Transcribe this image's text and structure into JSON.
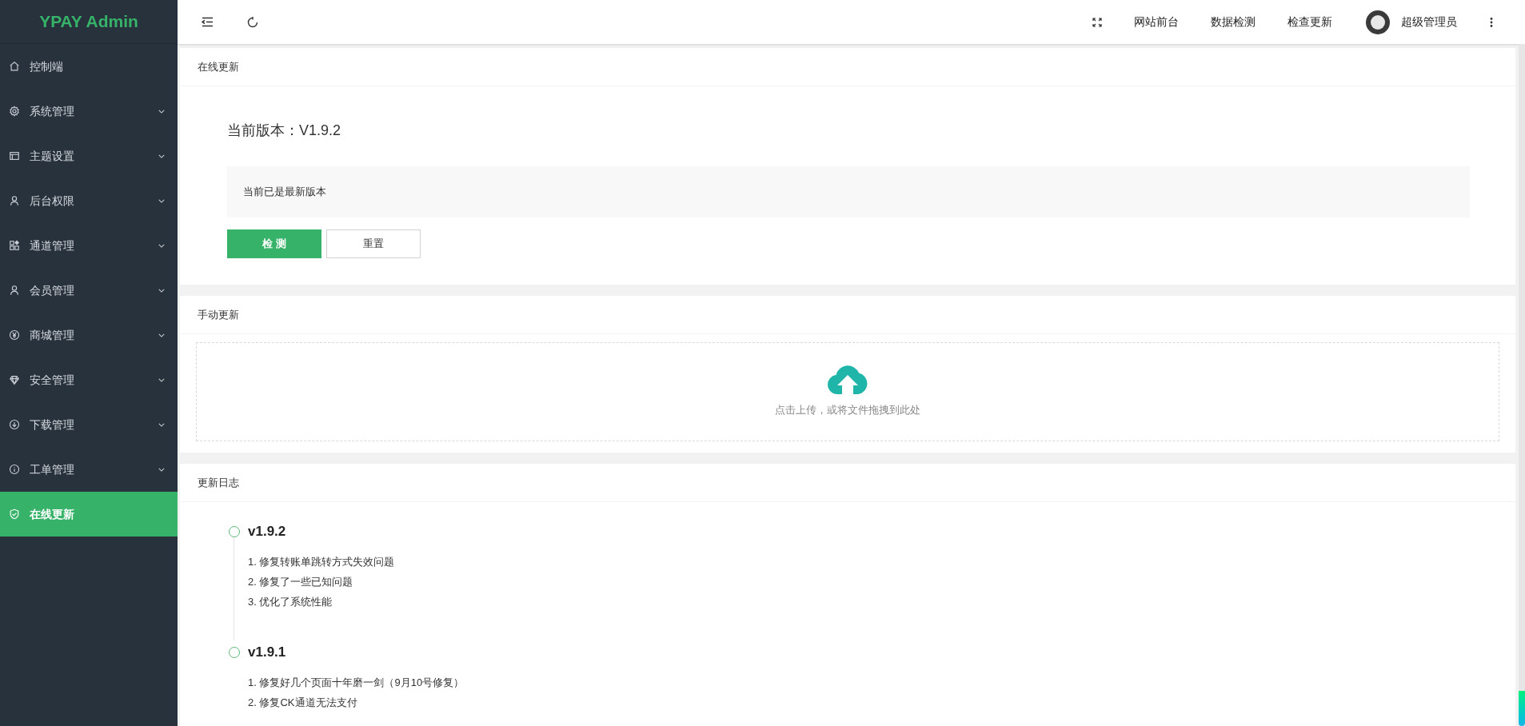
{
  "sidebar": {
    "logo": "YPAY Admin",
    "items": [
      {
        "label": "控制端",
        "selected": false
      },
      {
        "label": "系统管理",
        "expanded": false,
        "selected": false
      },
      {
        "label": "主题设置",
        "expanded": false,
        "selected": false
      },
      {
        "label": "后台权限",
        "expanded": false,
        "selected": false
      },
      {
        "label": "通道管理",
        "expanded": false,
        "selected": false
      },
      {
        "label": "会员管理",
        "expanded": false,
        "selected": false
      },
      {
        "label": "商城管理",
        "expanded": false,
        "selected": false
      },
      {
        "label": "安全管理",
        "expanded": false,
        "selected": false
      },
      {
        "label": "下载管理",
        "expanded": false,
        "selected": false
      },
      {
        "label": "工单管理",
        "expanded": false,
        "selected": false
      },
      {
        "label": "在线更新",
        "selected": true
      }
    ]
  },
  "header": {
    "links": [
      "网站前台",
      "数据检测",
      "检查更新"
    ],
    "user": "超级管理员"
  },
  "online_update": {
    "title": "在线更新",
    "version": "当前版本：V1.9.2",
    "notice": "当前已是最新版本",
    "buttons": [
      {
        "label": "检 测",
        "kind": "primary"
      },
      {
        "label": "重置",
        "kind": "default"
      }
    ]
  },
  "manual_update": {
    "title": "手动更新",
    "hint": "点击上传，或将文件拖拽到此处"
  },
  "changelog": {
    "title": "更新日志",
    "entries": [
      {
        "version": "v1.9.2",
        "items": [
          "1. 修复转账单跳转方式失效问题",
          "2. 修复了一些已知问题",
          "3. 优化了系统性能"
        ]
      },
      {
        "version": "v1.9.1",
        "items": [
          "1. 修复好几个页面十年磨一剑（9月10号修复）",
          "2. 修复CK通道无法支付"
        ]
      }
    ]
  }
}
